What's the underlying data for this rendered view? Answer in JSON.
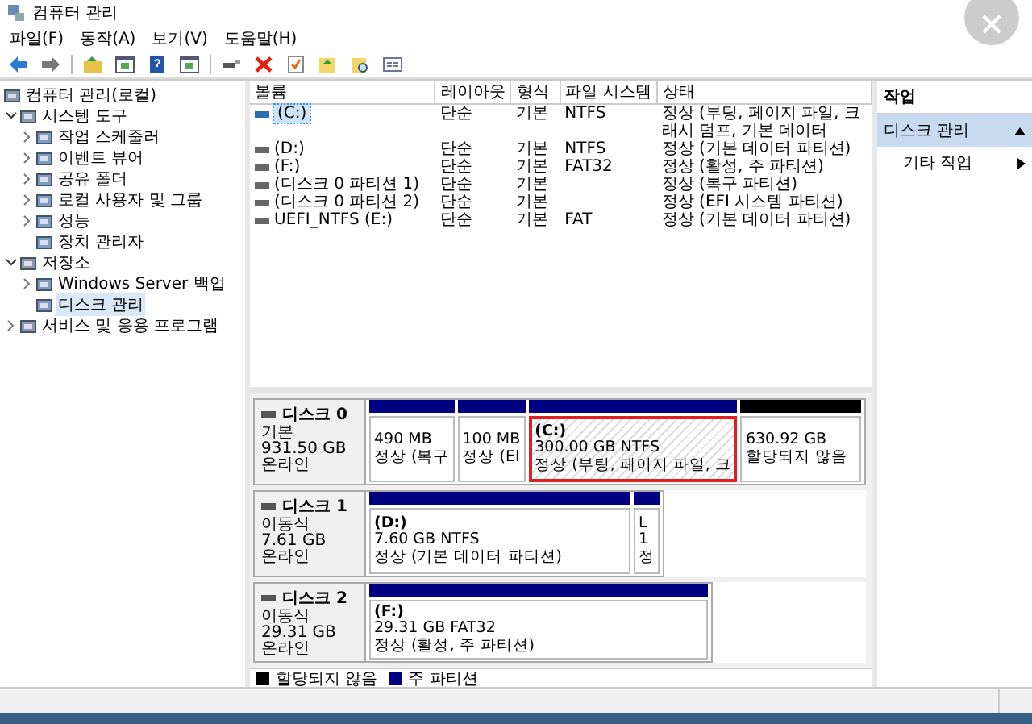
{
  "window": {
    "title": "컴퓨터 관리"
  },
  "menu": [
    "파일(F)",
    "동작(A)",
    "보기(V)",
    "도움말(H)"
  ],
  "tree": [
    {
      "label": "컴퓨터 관리(로컬)",
      "kind": "root",
      "selected": false,
      "children": [
        {
          "label": "시스템 도구",
          "kind": "branch",
          "expanded": true,
          "selected": false,
          "children": [
            {
              "label": "작업 스케줄러",
              "kind": "branch",
              "expanded": false,
              "selected": false
            },
            {
              "label": "이벤트 뷰어",
              "kind": "branch",
              "expanded": false,
              "selected": false
            },
            {
              "label": "공유 폴더",
              "kind": "branch",
              "expanded": false,
              "selected": false
            },
            {
              "label": "로컬 사용자 및 그룹",
              "kind": "branch",
              "expanded": false,
              "selected": false
            },
            {
              "label": "성능",
              "kind": "branch",
              "expanded": false,
              "selected": false
            },
            {
              "label": "장치 관리자",
              "kind": "leaf",
              "selected": false
            }
          ]
        },
        {
          "label": "저장소",
          "kind": "branch",
          "expanded": true,
          "selected": false,
          "children": [
            {
              "label": "Windows Server 백업",
              "kind": "branch",
              "expanded": false,
              "selected": false
            },
            {
              "label": "디스크 관리",
              "kind": "leaf",
              "selected": true
            }
          ]
        },
        {
          "label": "서비스 및 응용 프로그램",
          "kind": "branch",
          "expanded": false,
          "selected": false
        }
      ]
    }
  ],
  "table": {
    "columns": [
      "볼륨",
      "레이아웃",
      "형식",
      "파일 시스템",
      "상태"
    ],
    "rows": [
      {
        "volume": "(C:)",
        "layout": "단순",
        "type": "기본",
        "file_system": "NTFS",
        "status": "정상 (부팅, 페이지 파일, 크래시 덤프, 기본 데이터",
        "selected": true
      },
      {
        "volume": "(D:)",
        "layout": "단순",
        "type": "기본",
        "file_system": "NTFS",
        "status": "정상 (기본 데이터 파티션)",
        "selected": false
      },
      {
        "volume": "(F:)",
        "layout": "단순",
        "type": "기본",
        "file_system": "FAT32",
        "status": "정상 (활성, 주 파티션)",
        "selected": false
      },
      {
        "volume": "(디스크 0 파티션 1)",
        "layout": "단순",
        "type": "기본",
        "status": "정상 (복구 파티션)",
        "selected": false
      },
      {
        "volume": "(디스크 0 파티션 2)",
        "layout": "단순",
        "type": "기본",
        "status": "정상 (EFI 시스템 파티션)",
        "selected": false
      },
      {
        "volume": "UEFI_NTFS (E:)",
        "layout": "단순",
        "type": "기본",
        "file_system": "FAT",
        "status": "정상 (기본 데이터 파티션)",
        "selected": false
      }
    ]
  },
  "disks": [
    {
      "name": "디스크 0",
      "type": "기본",
      "size": "931.50 GB",
      "status": "온라인",
      "partitions": [
        {
          "kind": "primary",
          "lines": [
            "490 MB",
            "정상 (복구"
          ],
          "selected": false,
          "highlighted": false
        },
        {
          "kind": "primary",
          "lines": [
            "100 MB",
            "정상 (EI"
          ],
          "selected": false,
          "highlighted": false
        },
        {
          "kind": "primary",
          "name": "(C:)",
          "lines": [
            "300.00 GB NTFS",
            "정상 (부팅, 페이지 파일, 크"
          ],
          "selected": true,
          "highlighted": true
        },
        {
          "kind": "unallocated",
          "lines": [
            "630.92 GB",
            "할당되지 않음"
          ],
          "selected": false,
          "highlighted": false
        }
      ]
    },
    {
      "name": "디스크 1",
      "type": "이동식",
      "size": "7.61 GB",
      "status": "온라인",
      "partitions": [
        {
          "kind": "primary",
          "name": "(D:)",
          "lines": [
            "7.60 GB NTFS",
            "정상 (기본 데이터 파티션)"
          ],
          "selected": false,
          "highlighted": false
        },
        {
          "kind": "primary",
          "lines": [
            "L",
            "1",
            "정"
          ],
          "selected": false,
          "highlighted": false
        }
      ]
    },
    {
      "name": "디스크 2",
      "type": "이동식",
      "size": "29.31 GB",
      "status": "온라인",
      "partitions": [
        {
          "kind": "primary",
          "name": "(F:)",
          "lines": [
            "29.31 GB FAT32",
            "정상 (활성, 주 파티션)"
          ],
          "selected": false,
          "highlighted": false
        }
      ]
    }
  ],
  "legend": [
    {
      "label": "할당되지 않음",
      "color": "#000000"
    },
    {
      "label": "주 파티션",
      "color": "#000080"
    }
  ],
  "actions": {
    "header": "작업",
    "section": {
      "label": "디스크 관리",
      "expanded": true
    },
    "items": [
      {
        "label": "기타 작업"
      }
    ]
  }
}
